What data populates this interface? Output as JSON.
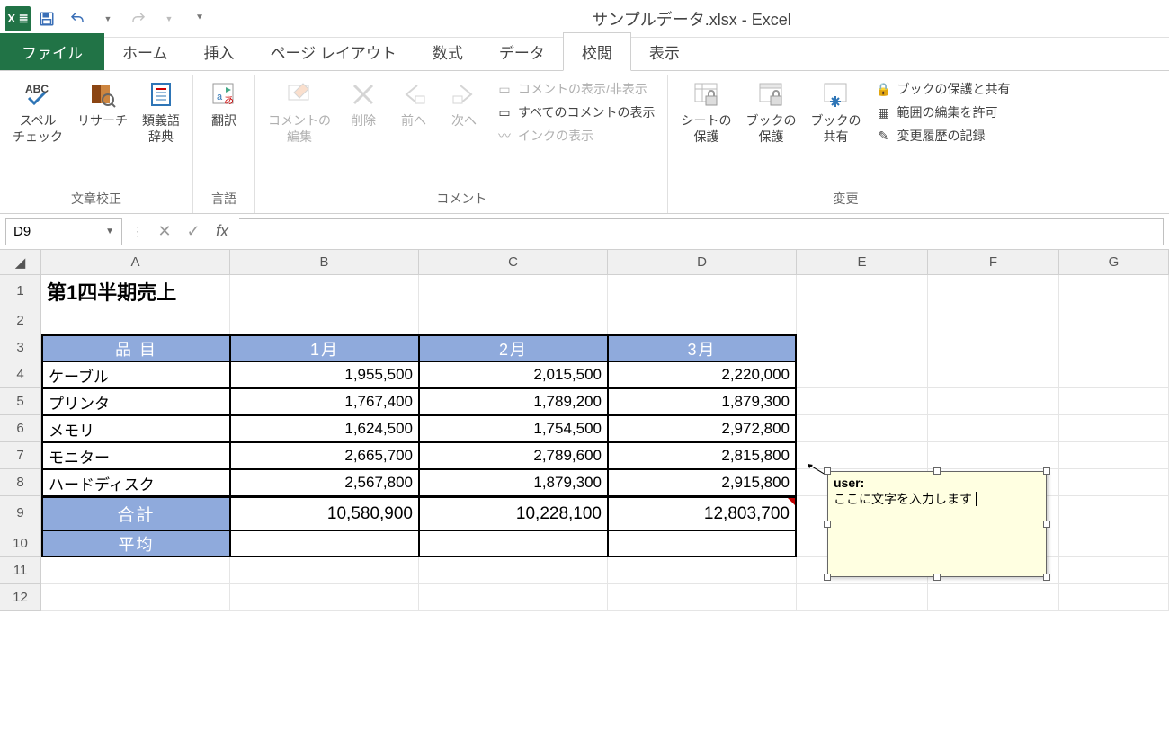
{
  "title": "サンプルデータ.xlsx - Excel",
  "qat": {
    "undo": "↶",
    "redo": "↷"
  },
  "tabs": {
    "file": "ファイル",
    "home": "ホーム",
    "insert": "挿入",
    "page_layout": "ページ レイアウト",
    "formulas": "数式",
    "data": "データ",
    "review": "校閲",
    "view": "表示"
  },
  "ribbon": {
    "proofing": {
      "label": "文章校正",
      "spelling": "スペル\nチェック",
      "research": "リサーチ",
      "thesaurus": "類義語\n辞典"
    },
    "language": {
      "label": "言語",
      "translate": "翻訳"
    },
    "comments": {
      "label": "コメント",
      "edit": "コメントの\n編集",
      "delete": "削除",
      "prev": "前へ",
      "next": "次へ",
      "show_hide": "コメントの表示/非表示",
      "show_all": "すべてのコメントの表示",
      "show_ink": "インクの表示"
    },
    "changes": {
      "label": "変更",
      "protect_sheet": "シートの\n保護",
      "protect_book": "ブックの\n保護",
      "share_book": "ブックの\n共有",
      "protect_share": "ブックの保護と共有",
      "allow_edit": "範囲の編集を許可",
      "track_changes": "変更履歴の記録"
    }
  },
  "namebox": "D9",
  "columns": [
    "A",
    "B",
    "C",
    "D",
    "E",
    "F",
    "G"
  ],
  "rows": [
    "1",
    "2",
    "3",
    "4",
    "5",
    "6",
    "7",
    "8",
    "9",
    "10",
    "11",
    "12"
  ],
  "sheet": {
    "title": "第1四半期売上",
    "headers": [
      "品 目",
      "1月",
      "2月",
      "3月"
    ],
    "data": [
      {
        "item": "ケーブル",
        "m1": "1,955,500",
        "m2": "2,015,500",
        "m3": "2,220,000"
      },
      {
        "item": "プリンタ",
        "m1": "1,767,400",
        "m2": "1,789,200",
        "m3": "1,879,300"
      },
      {
        "item": "メモリ",
        "m1": "1,624,500",
        "m2": "1,754,500",
        "m3": "2,972,800"
      },
      {
        "item": "モニター",
        "m1": "2,665,700",
        "m2": "2,789,600",
        "m3": "2,815,800"
      },
      {
        "item": "ハードディスク",
        "m1": "2,567,800",
        "m2": "1,879,300",
        "m3": "2,915,800"
      }
    ],
    "total_label": "合計",
    "totals": [
      "10,580,900",
      "10,228,100",
      "12,803,700"
    ],
    "avg_label": "平均"
  },
  "comment": {
    "author": "user:",
    "text": "ここに文字を入力します"
  }
}
